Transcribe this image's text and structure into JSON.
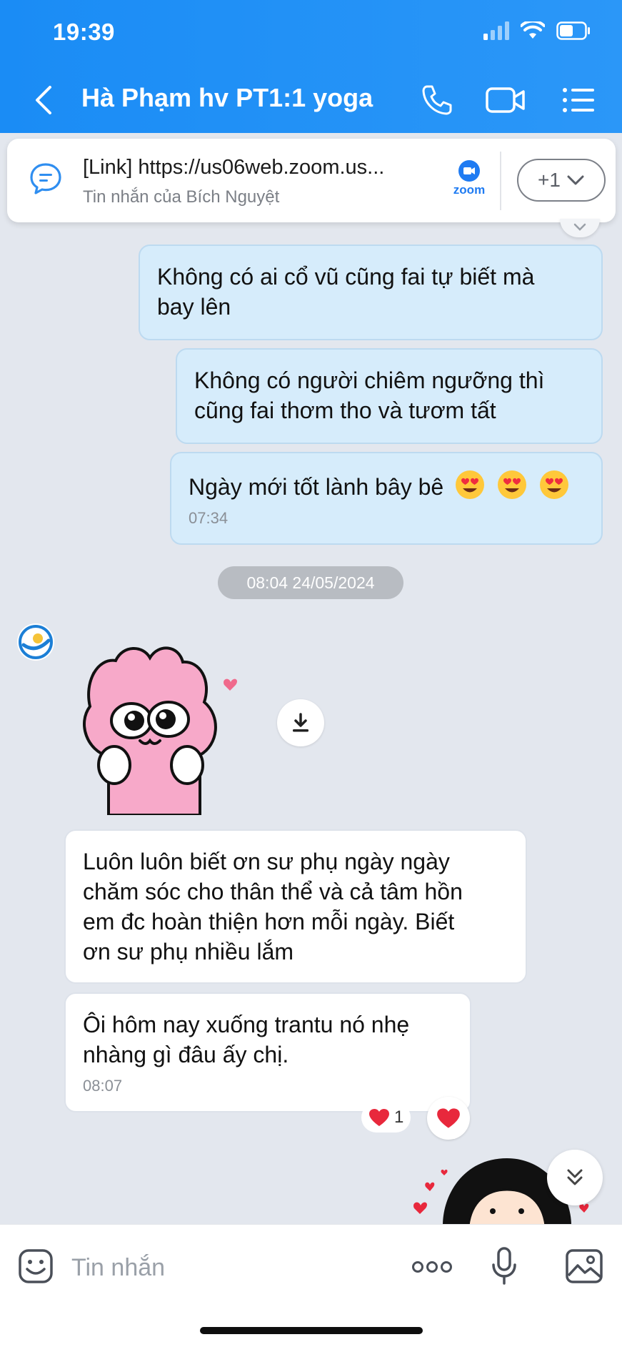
{
  "status_bar": {
    "time": "19:39"
  },
  "header": {
    "title": "Hà Phạm hv PT1:1 yoga"
  },
  "pinned": {
    "link_text": "[Link] https://us06web.zoom.us...",
    "subtitle": "Tin nhắn của Bích Nguyệt",
    "app_label": "zoom",
    "more_label": "+1"
  },
  "messages": [
    {
      "direction": "outgoing",
      "text_lines": [
        "Không có ai cổ vũ cũng fai tự biết mà",
        "bay lên"
      ]
    },
    {
      "direction": "outgoing",
      "text_lines": [
        "Không có người chiêm ngưỡng thì",
        "cũng fai thơm tho và tươm tất"
      ]
    },
    {
      "direction": "outgoing",
      "text": "Ngày mới tốt lành bây bê",
      "emoji": [
        "smiling-face-with-heart-eyes",
        "smiling-face-with-heart-eyes",
        "smiling-face-with-heart-eyes"
      ],
      "time": "07:34"
    },
    {
      "direction": "incoming",
      "text_lines": [
        "Luôn luôn biết ơn sư phụ ngày ngày",
        "chăm sóc cho thân thể và cả tâm hồn",
        "em đc hoàn thiện hơn mỗi ngày. Biết",
        "ơn sư phụ nhiều lắm"
      ]
    },
    {
      "direction": "incoming",
      "text_lines": [
        "Ôi hôm nay xuống trantu nó nhẹ",
        "nhàng gì đâu ấy chị."
      ],
      "time": "08:07"
    }
  ],
  "date_separator": "08:04 24/05/2024",
  "reactions": {
    "emoji": "red-heart",
    "count": "1"
  },
  "composer": {
    "placeholder": "Tin nhắn"
  },
  "colors": {
    "header": "#1a8cf5",
    "outgoing_bubble": "#d6ecfb",
    "incoming_bubble": "#ffffff",
    "chat_bg": "#e3e7ee",
    "accent": "#1f7bf2"
  }
}
